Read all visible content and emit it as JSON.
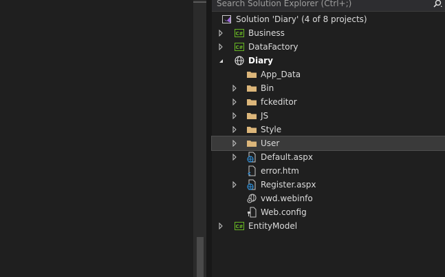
{
  "search": {
    "placeholder": "Search Solution Explorer (Ctrl+;)"
  },
  "tree": {
    "solution": "Solution 'Diary' (4 of 8 projects)",
    "business": "Business",
    "datafactory": "DataFactory",
    "diary": "Diary",
    "app_data": "App_Data",
    "bin": "Bin",
    "fckeditor": "fckeditor",
    "js": "JS",
    "style": "Style",
    "user": "User",
    "default_aspx": "Default.aspx",
    "error_htm": "error.htm",
    "register_aspx": "Register.aspx",
    "vwd_webinfo": "vwd.webinfo",
    "web_config": "Web.config",
    "entitymodel": "EntityModel"
  },
  "colors": {
    "background": "#1f1f1f",
    "folder": "#dcb67a",
    "csharp_project": "#68b723",
    "web_globe": "#2f8fd8",
    "selection": "#3a3a3a"
  }
}
